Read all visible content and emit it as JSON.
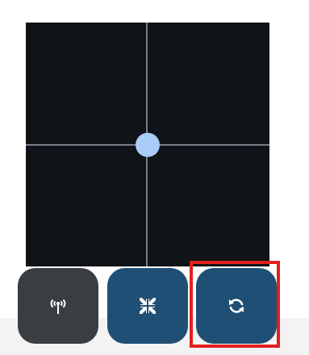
{
  "joystick": {
    "knob_position": {
      "x": 0.0,
      "y": 0.0
    }
  },
  "buttons": [
    {
      "id": "antenna",
      "icon": "antenna-signal-icon",
      "active": false
    },
    {
      "id": "center",
      "icon": "collapse-arrows-icon",
      "active": true
    },
    {
      "id": "refresh",
      "icon": "refresh-icon",
      "active": true
    }
  ],
  "colors": {
    "pad_background": "#101318",
    "crosshair": "#78808c",
    "knob": "#a9cdf6",
    "button_inactive": "#3a3d42",
    "button_active": "#1f4f74",
    "icon": "#ffffff",
    "highlight": "#e41e1e"
  }
}
